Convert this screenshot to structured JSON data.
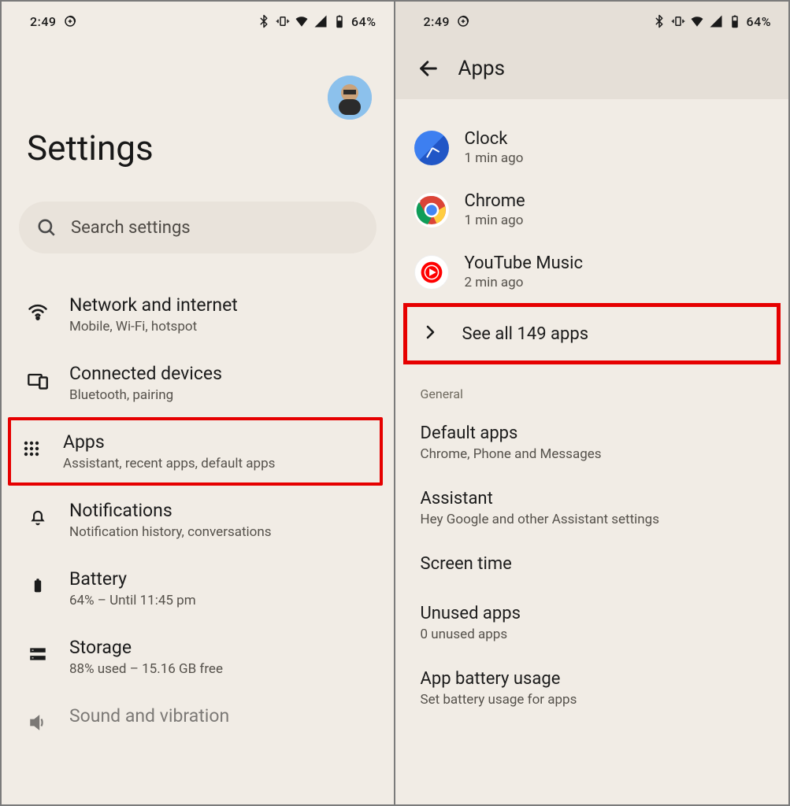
{
  "status": {
    "time": "2:49",
    "battery_pct": "64%"
  },
  "left": {
    "title": "Settings",
    "search_placeholder": "Search settings",
    "items": [
      {
        "title": "Network and internet",
        "sub": "Mobile, Wi-Fi, hotspot"
      },
      {
        "title": "Connected devices",
        "sub": "Bluetooth, pairing"
      },
      {
        "title": "Apps",
        "sub": "Assistant, recent apps, default apps"
      },
      {
        "title": "Notifications",
        "sub": "Notification history, conversations"
      },
      {
        "title": "Battery",
        "sub": "64% – Until 11:45 pm"
      },
      {
        "title": "Storage",
        "sub": "88% used – 15.16 GB free"
      },
      {
        "title": "Sound and vibration",
        "sub": ""
      }
    ]
  },
  "right": {
    "title": "Apps",
    "recent": [
      {
        "title": "Clock",
        "sub": "1 min ago"
      },
      {
        "title": "Chrome",
        "sub": "1 min ago"
      },
      {
        "title": "YouTube Music",
        "sub": "2 min ago"
      }
    ],
    "see_all": "See all 149 apps",
    "section_general": "General",
    "entries": [
      {
        "title": "Default apps",
        "sub": "Chrome, Phone and Messages"
      },
      {
        "title": "Assistant",
        "sub": "Hey Google and other Assistant settings"
      },
      {
        "title": "Screen time",
        "sub": ""
      },
      {
        "title": "Unused apps",
        "sub": "0 unused apps"
      },
      {
        "title": "App battery usage",
        "sub": "Set battery usage for apps"
      }
    ]
  }
}
